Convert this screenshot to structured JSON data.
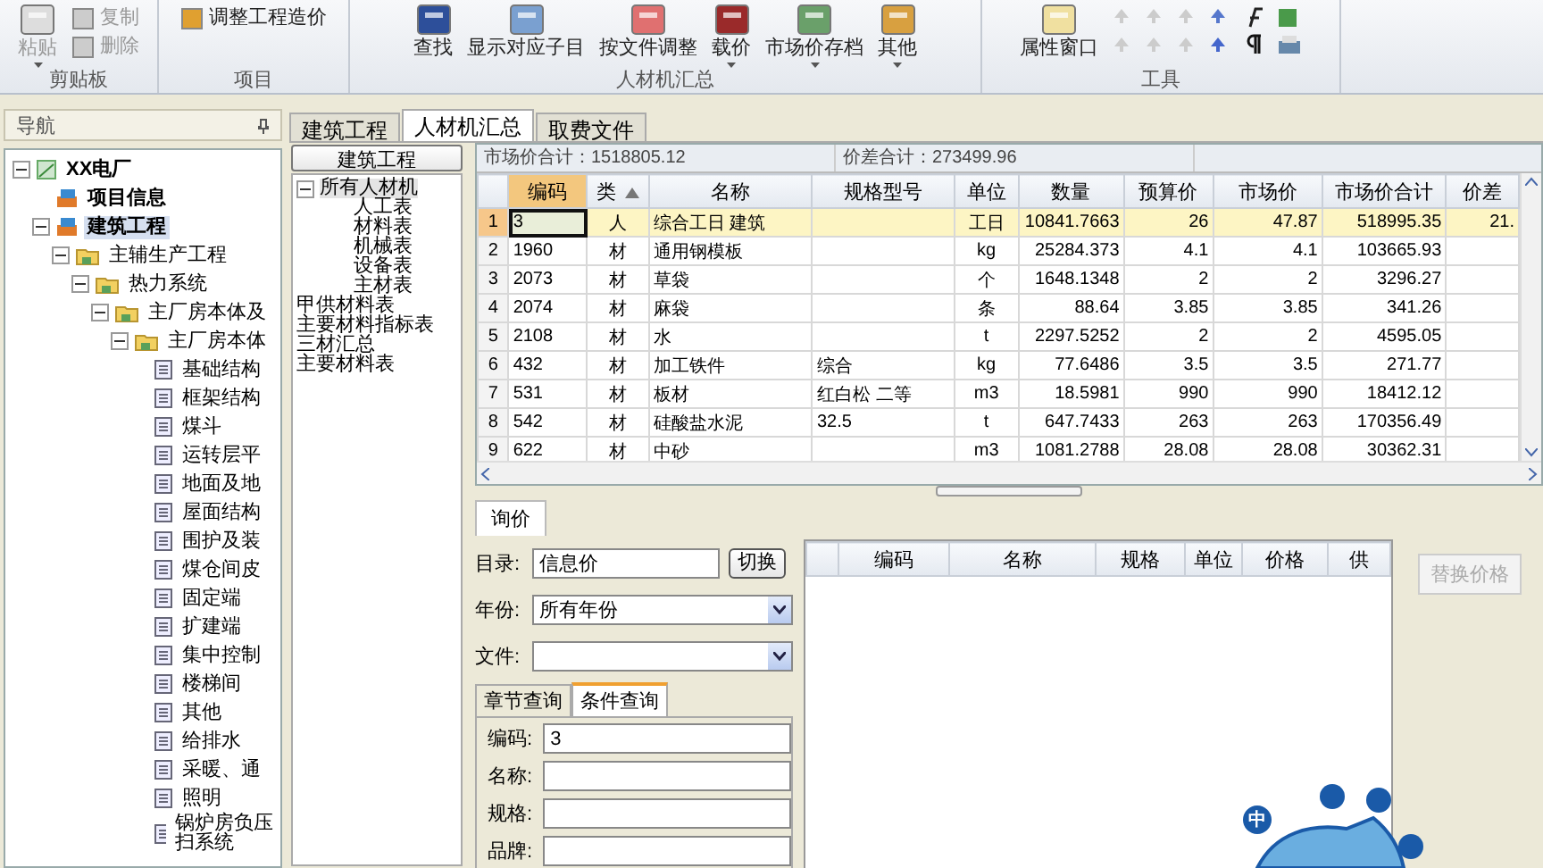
{
  "ribbon": {
    "groups": [
      {
        "label": "剪贴板",
        "items": [
          {
            "kind": "large",
            "label": "粘贴",
            "disabled": true,
            "dropdown": true
          },
          {
            "kind": "small",
            "label": "复制",
            "disabled": true
          },
          {
            "kind": "small",
            "label": "删除",
            "disabled": true
          }
        ]
      },
      {
        "label": "项目",
        "items": [
          {
            "kind": "small",
            "label": "调整工程造价",
            "disabled": false
          }
        ]
      },
      {
        "label": "人材机汇总",
        "items": [
          {
            "kind": "large",
            "label": "查找",
            "disabled": false,
            "dropdown": false
          },
          {
            "kind": "large",
            "label": "显示对应子目",
            "disabled": false,
            "dropdown": false
          },
          {
            "kind": "large",
            "label": "按文件调整",
            "disabled": false,
            "dropdown": false
          },
          {
            "kind": "large",
            "label": "载价",
            "disabled": false,
            "dropdown": true
          },
          {
            "kind": "large",
            "label": "市场价存档",
            "disabled": false,
            "dropdown": true
          },
          {
            "kind": "large",
            "label": "其他",
            "disabled": false,
            "dropdown": true
          }
        ]
      },
      {
        "label": "工具",
        "items": [
          {
            "kind": "large",
            "label": "属性窗口",
            "disabled": false,
            "dropdown": false
          },
          {
            "kind": "icons"
          }
        ]
      }
    ]
  },
  "navigator": {
    "title": "导航",
    "tree": [
      {
        "label": "XX电厂",
        "kind": "root",
        "selected": false,
        "expanded": true,
        "children": [
          {
            "label": "项目信息",
            "kind": "project",
            "selected": false
          },
          {
            "label": "建筑工程",
            "kind": "project",
            "selected": true,
            "expanded": true,
            "children": [
              {
                "label": "主辅生产工程",
                "kind": "folder",
                "selected": false,
                "expanded": true,
                "children": [
                  {
                    "label": "热力系统",
                    "kind": "folder",
                    "selected": false,
                    "expanded": true,
                    "children": [
                      {
                        "label": "主厂房本体及",
                        "kind": "folder",
                        "selected": false,
                        "expanded": true,
                        "children": [
                          {
                            "label": "主厂房本体",
                            "kind": "folder",
                            "selected": false,
                            "expanded": true,
                            "children": [
                              {
                                "label": "基础结构",
                                "kind": "sheet",
                                "selected": false
                              },
                              {
                                "label": "框架结构",
                                "kind": "sheet",
                                "selected": false
                              },
                              {
                                "label": "煤斗",
                                "kind": "sheet",
                                "selected": false
                              },
                              {
                                "label": "运转层平",
                                "kind": "sheet",
                                "selected": false
                              },
                              {
                                "label": "地面及地",
                                "kind": "sheet",
                                "selected": false
                              },
                              {
                                "label": "屋面结构",
                                "kind": "sheet",
                                "selected": false
                              },
                              {
                                "label": "围护及装",
                                "kind": "sheet",
                                "selected": false
                              },
                              {
                                "label": "煤仓间皮",
                                "kind": "sheet",
                                "selected": false
                              },
                              {
                                "label": "固定端",
                                "kind": "sheet",
                                "selected": false
                              },
                              {
                                "label": "扩建端",
                                "kind": "sheet",
                                "selected": false
                              },
                              {
                                "label": "集中控制",
                                "kind": "sheet",
                                "selected": false
                              },
                              {
                                "label": "楼梯间",
                                "kind": "sheet",
                                "selected": false
                              },
                              {
                                "label": "其他",
                                "kind": "sheet",
                                "selected": false
                              },
                              {
                                "label": "给排水",
                                "kind": "sheet",
                                "selected": false
                              },
                              {
                                "label": "采暖、通",
                                "kind": "sheet",
                                "selected": false
                              },
                              {
                                "label": "照明",
                                "kind": "sheet",
                                "selected": false
                              },
                              {
                                "label": "锅炉房负压扫系统",
                                "kind": "sheet",
                                "selected": false
                              }
                            ]
                          }
                        ]
                      }
                    ]
                  }
                ]
              }
            ]
          }
        ]
      }
    ]
  },
  "tabs": [
    {
      "label": "建筑工程",
      "selected": false
    },
    {
      "label": "人材机汇总",
      "selected": true
    },
    {
      "label": "取费文件",
      "selected": false
    }
  ],
  "category_panel": {
    "button": "建筑工程",
    "tree": [
      {
        "label": "所有人材机",
        "selected": true,
        "expanded": true,
        "children": [
          {
            "label": "人工表",
            "selected": false
          },
          {
            "label": "材料表",
            "selected": false
          },
          {
            "label": "机械表",
            "selected": false
          },
          {
            "label": "设备表",
            "selected": false
          },
          {
            "label": "主材表",
            "selected": false
          }
        ]
      },
      {
        "label": "甲供材料表",
        "selected": false
      },
      {
        "label": "主要材料指标表",
        "selected": false
      },
      {
        "label": "三材汇总",
        "selected": false
      },
      {
        "label": "主要材料表",
        "selected": false
      }
    ]
  },
  "summary": [
    "市场价合计：1518805.12",
    "价差合计：273499.96"
  ],
  "table": {
    "columns": [
      {
        "label": "编码",
        "highlighted": true,
        "sorted": false
      },
      {
        "label": "类",
        "highlighted": false,
        "sorted": true
      },
      {
        "label": "名称",
        "highlighted": false,
        "sorted": false
      },
      {
        "label": "规格型号",
        "highlighted": false,
        "sorted": false
      },
      {
        "label": "单位",
        "highlighted": false,
        "sorted": false
      },
      {
        "label": "数量",
        "highlighted": false,
        "sorted": false
      },
      {
        "label": "预算价",
        "highlighted": false,
        "sorted": false
      },
      {
        "label": "市场价",
        "highlighted": false,
        "sorted": false
      },
      {
        "label": "市场价合计",
        "highlighted": false,
        "sorted": false
      },
      {
        "label": "价差",
        "highlighted": false,
        "sorted": false
      }
    ],
    "rows": [
      {
        "number": "1",
        "selected": true,
        "cells": [
          "3",
          "人",
          "综合工日 建筑",
          "",
          "工日",
          "10841.7663",
          "26",
          "47.87",
          "518995.35",
          "21."
        ]
      },
      {
        "number": "2",
        "selected": false,
        "cells": [
          "1960",
          "材",
          "通用钢模板",
          "",
          "kg",
          "25284.373",
          "4.1",
          "4.1",
          "103665.93",
          ""
        ]
      },
      {
        "number": "3",
        "selected": false,
        "cells": [
          "2073",
          "材",
          "草袋",
          "",
          "个",
          "1648.1348",
          "2",
          "2",
          "3296.27",
          ""
        ]
      },
      {
        "number": "4",
        "selected": false,
        "cells": [
          "2074",
          "材",
          "麻袋",
          "",
          "条",
          "88.64",
          "3.85",
          "3.85",
          "341.26",
          ""
        ]
      },
      {
        "number": "5",
        "selected": false,
        "cells": [
          "2108",
          "材",
          "水",
          "",
          "t",
          "2297.5252",
          "2",
          "2",
          "4595.05",
          ""
        ]
      },
      {
        "number": "6",
        "selected": false,
        "cells": [
          "432",
          "材",
          "加工铁件",
          "综合",
          "kg",
          "77.6486",
          "3.5",
          "3.5",
          "271.77",
          ""
        ]
      },
      {
        "number": "7",
        "selected": false,
        "cells": [
          "531",
          "材",
          "板材",
          "红白松 二等",
          "m3",
          "18.5981",
          "990",
          "990",
          "18412.12",
          ""
        ]
      },
      {
        "number": "8",
        "selected": false,
        "cells": [
          "542",
          "材",
          "硅酸盐水泥",
          "32.5",
          "t",
          "647.7433",
          "263",
          "263",
          "170356.49",
          ""
        ]
      },
      {
        "number": "9",
        "selected": false,
        "cells": [
          "622",
          "材",
          "中砂",
          "",
          "m3",
          "1081.2788",
          "28.08",
          "28.08",
          "30362.31",
          ""
        ]
      }
    ]
  },
  "inquiry": {
    "tab": "询价",
    "catalog": {
      "label": "目录:",
      "value": "信息价",
      "button": "切换"
    },
    "year": {
      "label": "年份:",
      "value": "所有年份"
    },
    "file": {
      "label": "文件:"
    },
    "subtabs": [
      {
        "label": "章节查询",
        "selected": false
      },
      {
        "label": "条件查询",
        "selected": true
      }
    ],
    "fields": [
      {
        "label": "编码:",
        "value": "3"
      },
      {
        "label": "名称:"
      },
      {
        "label": "规格:"
      },
      {
        "label": "品牌:"
      }
    ],
    "price_columns": [
      "编码",
      "名称",
      "规格",
      "单位",
      "价格",
      "供"
    ],
    "replace_button": {
      "label": "替换价格",
      "disabled": true
    }
  },
  "ime_toolbar": {
    "label": "中"
  }
}
